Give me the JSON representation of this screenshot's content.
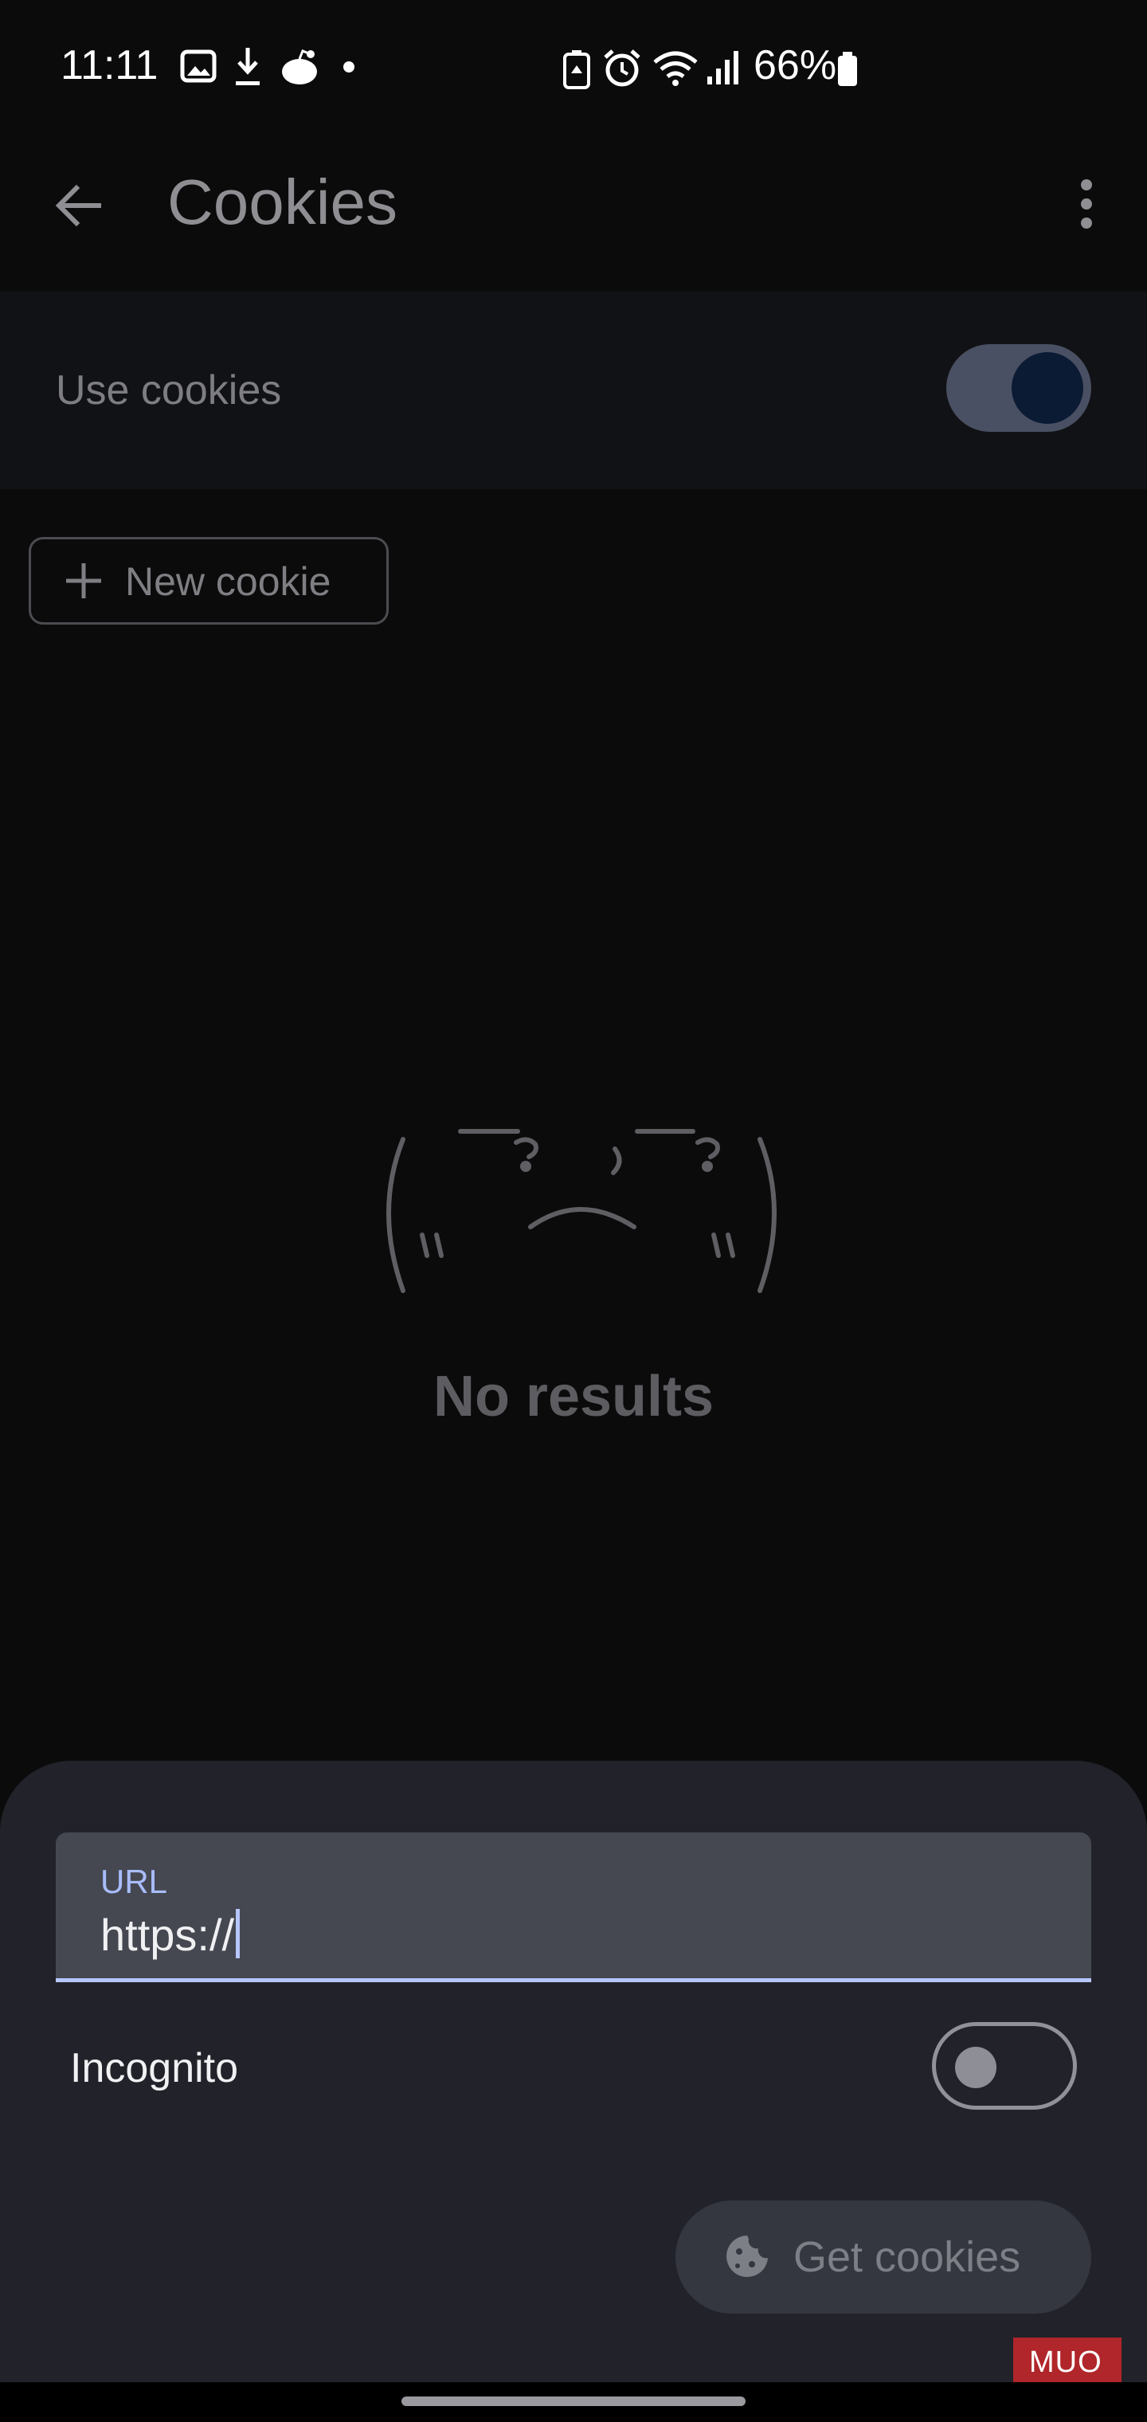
{
  "status_bar": {
    "time": "11:11",
    "battery_percent": "66%",
    "icons": [
      "gallery-icon",
      "download-icon",
      "reddit-icon",
      "dot-icon",
      "battery-saver-icon",
      "alarm-icon",
      "wifi-icon",
      "signal-icon",
      "battery-icon"
    ]
  },
  "app_bar": {
    "title": "Cookies",
    "back_icon": "arrow-left-icon",
    "menu_icon": "more-vertical-icon"
  },
  "use_cookies": {
    "label": "Use cookies",
    "enabled": true
  },
  "new_cookie_button": {
    "label": "New cookie",
    "icon": "plus-icon"
  },
  "empty_state": {
    "emoticon": "( ˵ °□° ˵ )",
    "text": "No results"
  },
  "sheet": {
    "url_field": {
      "label": "URL",
      "value": "https://"
    },
    "incognito": {
      "label": "Incognito",
      "enabled": false
    },
    "get_cookies_button": {
      "label": "Get cookies",
      "icon": "cookie-icon"
    }
  },
  "watermark": {
    "text": "MUO"
  },
  "colors": {
    "background": "#0b0b0c",
    "sheet": "#22232a",
    "accent": "#b6c6ff",
    "toggle_on_track": "#4a5063",
    "toggle_on_knob": "#0b1b33"
  }
}
